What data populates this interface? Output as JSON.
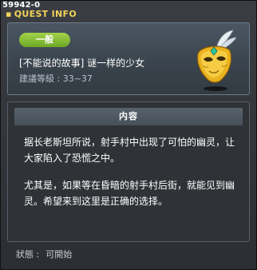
{
  "window": {
    "quest_id": "59942-0",
    "title": "QUEST INFO"
  },
  "header": {
    "category_badge": "一般",
    "quest_name": "[不能说的故事] 谜一样的少女",
    "recommended_level": "建議等級 : 33~37",
    "icon": "golden-mask-icon"
  },
  "content": {
    "section_title": "内容",
    "paragraphs": [
      "据长老斯坦所说，射手村中出现了可怕的幽灵，让大家陷入了恐慌之中。",
      "尤其是，如果等在昏暗的射手村后街，就能见到幽灵。希望来到这里是正确的选择。"
    ]
  },
  "status": {
    "label": "狀態 :",
    "value": "可開始"
  },
  "colors": {
    "title_accent": "#f2d25a",
    "badge_green": "#8cc63a",
    "text": "#ffffff"
  }
}
